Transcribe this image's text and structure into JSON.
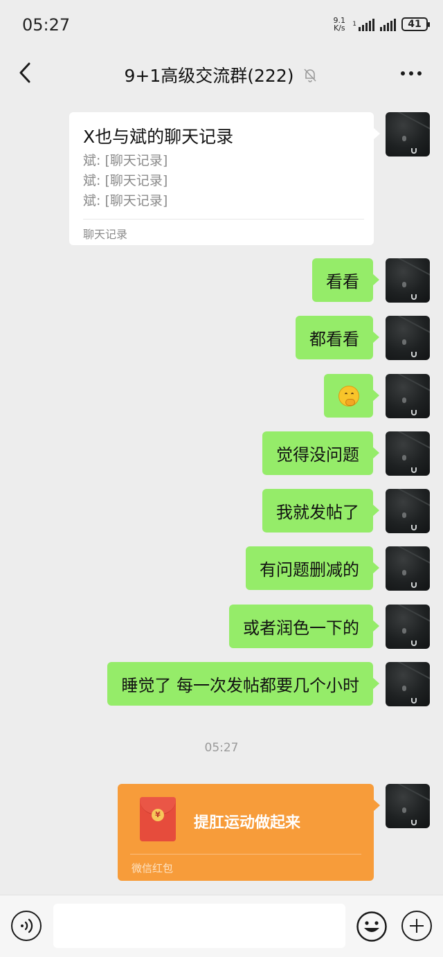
{
  "status_bar": {
    "time": "05:27",
    "net_speed_value": "9.1",
    "net_speed_unit": "K/s",
    "battery": "41"
  },
  "header": {
    "title": "9+1高级交流群(222)",
    "back_icon": "chevron-left-icon",
    "mute_icon": "bell-off-icon",
    "more_icon": "more-dots-icon"
  },
  "messages": {
    "chat_record": {
      "title": "X也与斌的聊天记录",
      "lines": [
        "斌: [聊天记录]",
        "斌: [聊天记录]",
        "斌: [聊天记录]"
      ],
      "footer": "聊天记录"
    },
    "texts": [
      "看看",
      "都看看",
      "觉得没问题",
      "我就发帖了",
      "有问题删减的",
      "或者润色一下的",
      "睡觉了 每一次发帖都要几个小时"
    ],
    "emoji_message": "grinning-hand-face-emoji",
    "time_divider": "05:27",
    "red_packet": {
      "title": "提肛运动做起来",
      "footer": "微信红包",
      "coin_symbol": "¥"
    }
  },
  "input_bar": {
    "placeholder": "",
    "voice_icon": "voice-icon",
    "emoji_icon": "emoji-icon",
    "plus_icon": "plus-icon"
  },
  "colors": {
    "background": "#ededed",
    "bubble_green": "#95ec69",
    "red_packet_orange": "#f79c3a"
  }
}
